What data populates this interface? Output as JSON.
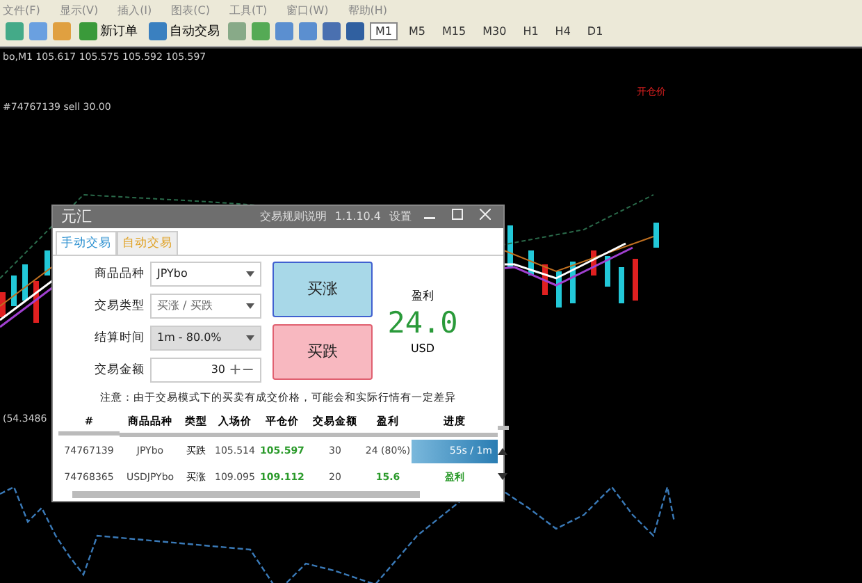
{
  "menu": [
    "文件(F)",
    "显示(V)",
    "插入(I)",
    "图表(C)",
    "工具(T)",
    "窗口(W)",
    "帮助(H)"
  ],
  "toolbar": {
    "new_order": "新订单",
    "auto_trade": "自动交易",
    "timeframes": [
      {
        "label": "M1",
        "selected": true
      },
      {
        "label": "M5",
        "selected": false
      },
      {
        "label": "M15",
        "selected": false
      },
      {
        "label": "M30",
        "selected": false
      },
      {
        "label": "H1",
        "selected": false
      },
      {
        "label": "H4",
        "selected": false
      },
      {
        "label": "D1",
        "selected": false
      }
    ]
  },
  "chart": {
    "info": "bo,M1 105.617 105.575 105.592 105.597",
    "order_line": "#74767139 sell 30.00",
    "marker": "开仓价",
    "indicator": "(54.3486"
  },
  "dialog": {
    "title": "元汇",
    "rules": "交易规则说明",
    "version": "1.1.10.4",
    "settings": "设置",
    "tabs": [
      {
        "label": "手动交易",
        "selected": true
      },
      {
        "label": "自动交易",
        "selected": false
      }
    ],
    "fields": [
      {
        "label": "商品品种",
        "value": "JPYbo",
        "kind": "select",
        "disabled": false
      },
      {
        "label": "交易类型",
        "value": "买涨 / 买跌",
        "kind": "select",
        "disabled": true
      },
      {
        "label": "结算时间",
        "value": "1m - 80.0%",
        "kind": "select",
        "disabled": false
      },
      {
        "label": "交易金额",
        "value": "30",
        "kind": "stepper",
        "disabled": false
      }
    ],
    "stepper": [
      "+",
      "−"
    ],
    "buy_up": "买涨",
    "buy_down": "买跌",
    "profit": {
      "label": "盈利",
      "value": "24.0",
      "unit": "USD"
    },
    "notice": "注意：由于交易模式下的买卖有成交价格，可能会和实际行情有一定差异",
    "columns": [
      "#",
      "商品品种",
      "类型",
      "入场价",
      "平仓价",
      "交易金额",
      "盈利",
      "进度"
    ],
    "rows": [
      {
        "id": "74767139",
        "symbol": "JPYbo",
        "type": "买跌",
        "entry": "105.514",
        "close": "105.597",
        "amount": "30",
        "profit": "24 (80%)",
        "progress": {
          "kind": "bar",
          "text": "55s / 1m",
          "level": 1
        }
      },
      {
        "id": "74768365",
        "symbol": "USDJPYbo",
        "type": "买涨",
        "entry": "109.095",
        "close": "109.112",
        "amount": "20",
        "profit": "15.6",
        "progress": {
          "kind": "text",
          "text": "盈利"
        }
      }
    ]
  }
}
